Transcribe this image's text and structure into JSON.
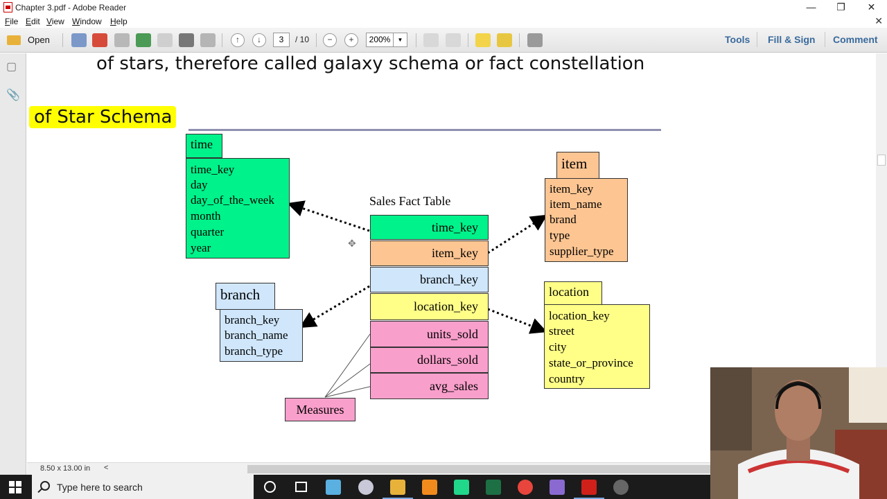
{
  "window": {
    "title": "Chapter 3.pdf - Adobe Reader"
  },
  "menu": {
    "items": [
      [
        "F",
        "ile"
      ],
      [
        "E",
        "dit"
      ],
      [
        "V",
        "iew"
      ],
      [
        "W",
        "indow"
      ],
      [
        "H",
        "elp"
      ]
    ]
  },
  "toolbar": {
    "open_label": "Open",
    "page_current": "3",
    "page_total": "/ 10",
    "zoom": "200%",
    "tools_label": "Tools",
    "fill_sign_label": "Fill & Sign",
    "comment_label": "Comment"
  },
  "document": {
    "heading_line": "of stars, therefore called galaxy schema or fact constellation",
    "section_title": "of Star Schema",
    "diagram": {
      "fact_table_title": "Sales Fact Table",
      "fact_rows": [
        "time_key",
        "item_key",
        "branch_key",
        "location_key",
        "units_sold",
        "dollars_sold",
        "avg_sales"
      ],
      "measures_label": "Measures",
      "time": {
        "name": "time",
        "fields": [
          "time_key",
          "day",
          "day_of_the_week",
          "month",
          "quarter",
          "year"
        ]
      },
      "item": {
        "name": "item",
        "fields": [
          "item_key",
          "item_name",
          "brand",
          "type",
          "supplier_type"
        ]
      },
      "branch": {
        "name": "branch",
        "fields": [
          "branch_key",
          "branch_name",
          "branch_type"
        ]
      },
      "location": {
        "name": "location",
        "fields": [
          "location_key",
          "street",
          "city",
          "state_or_province",
          "country"
        ]
      }
    },
    "colors": {
      "time": "#00f28a",
      "item": "#fdc592",
      "branch": "#cfe6fb",
      "location": "#ffff88",
      "measures": "#f99fcb"
    }
  },
  "status": {
    "page_size": "8.50 x 13.00 in"
  },
  "taskbar": {
    "search_placeholder": "Type here to search"
  }
}
